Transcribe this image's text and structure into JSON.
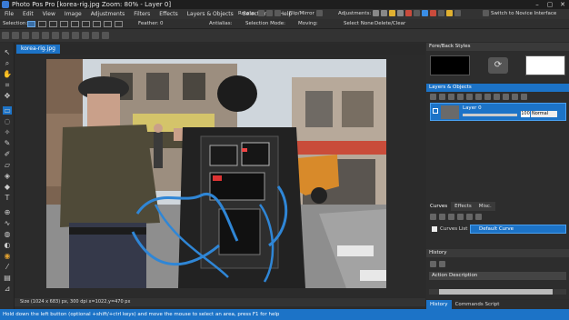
{
  "window": {
    "title": "Photo Pos Pro [korea-rig.jpg Zoom: 80% - Layer 0]",
    "controls": [
      "–",
      "▢",
      "✕"
    ]
  },
  "menus": [
    "File",
    "Edit",
    "View",
    "Image",
    "Adjustments",
    "Filters",
    "Effects",
    "Layers & Objects",
    "Selections",
    "Help"
  ],
  "menubar_controls": {
    "rotate": "Rotate:",
    "flip": "Flip/Mirror",
    "adjustments": "Adjustments:",
    "novice": "Switch to Novice Interface"
  },
  "selection_toolbar": {
    "selection": "Selection:",
    "feather_label": "Feather:",
    "feather_value": "0",
    "antialias": "Antialias:",
    "selection_mode": "Selection Mode:",
    "moving": "Moving:",
    "select_none": "Select None",
    "delete_clear": "Delete/Clear"
  },
  "document": {
    "tab": "korea-rig.jpg"
  },
  "status": {
    "size": "Size (1024 x 683) px, 300 dpi   x=1022,y=470 px"
  },
  "hint": "Hold down the left button (optional +shift/+ctrl keys) and move the mouse to select an area, press F1 for help",
  "panels": {
    "fore_back": {
      "title": "Fore/Back Styles",
      "fore_color": "#000000",
      "back_color": "#ffffff",
      "swap_icon": "⟳"
    },
    "layers": {
      "title": "Layers & Objects",
      "layer_name": "Layer 0",
      "opacity": "100",
      "mode": "Normal"
    },
    "effects_tabs": {
      "tabs": [
        "Curves",
        "Effects",
        "Misc."
      ],
      "curves_list": "Curves List",
      "default_curve": "Default Curve"
    },
    "history": {
      "title": "History",
      "column": "Action Description"
    },
    "bottom_tabs": [
      "History",
      "Commands Script"
    ]
  },
  "colors": {
    "accent": "#1c73c7",
    "background": "#2b2b2b"
  }
}
